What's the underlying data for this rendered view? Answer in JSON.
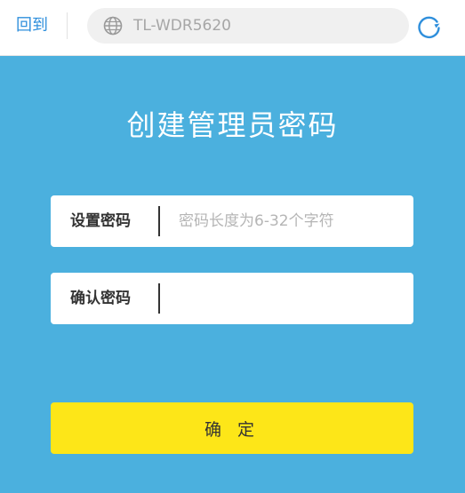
{
  "toolbar": {
    "back_label": "回到",
    "url": "TL-WDR5620"
  },
  "main": {
    "title": "创建管理员密码",
    "password_field": {
      "label": "设置密码",
      "placeholder": "密码长度为6-32个字符",
      "value": ""
    },
    "confirm_field": {
      "label": "确认密码",
      "placeholder": "",
      "value": ""
    },
    "confirm_button_label": "确 定"
  },
  "colors": {
    "background": "#4bb0de",
    "button": "#fde618",
    "link": "#2f8fdc"
  },
  "icons": {
    "address": "globe-icon",
    "reload": "refresh-icon"
  }
}
